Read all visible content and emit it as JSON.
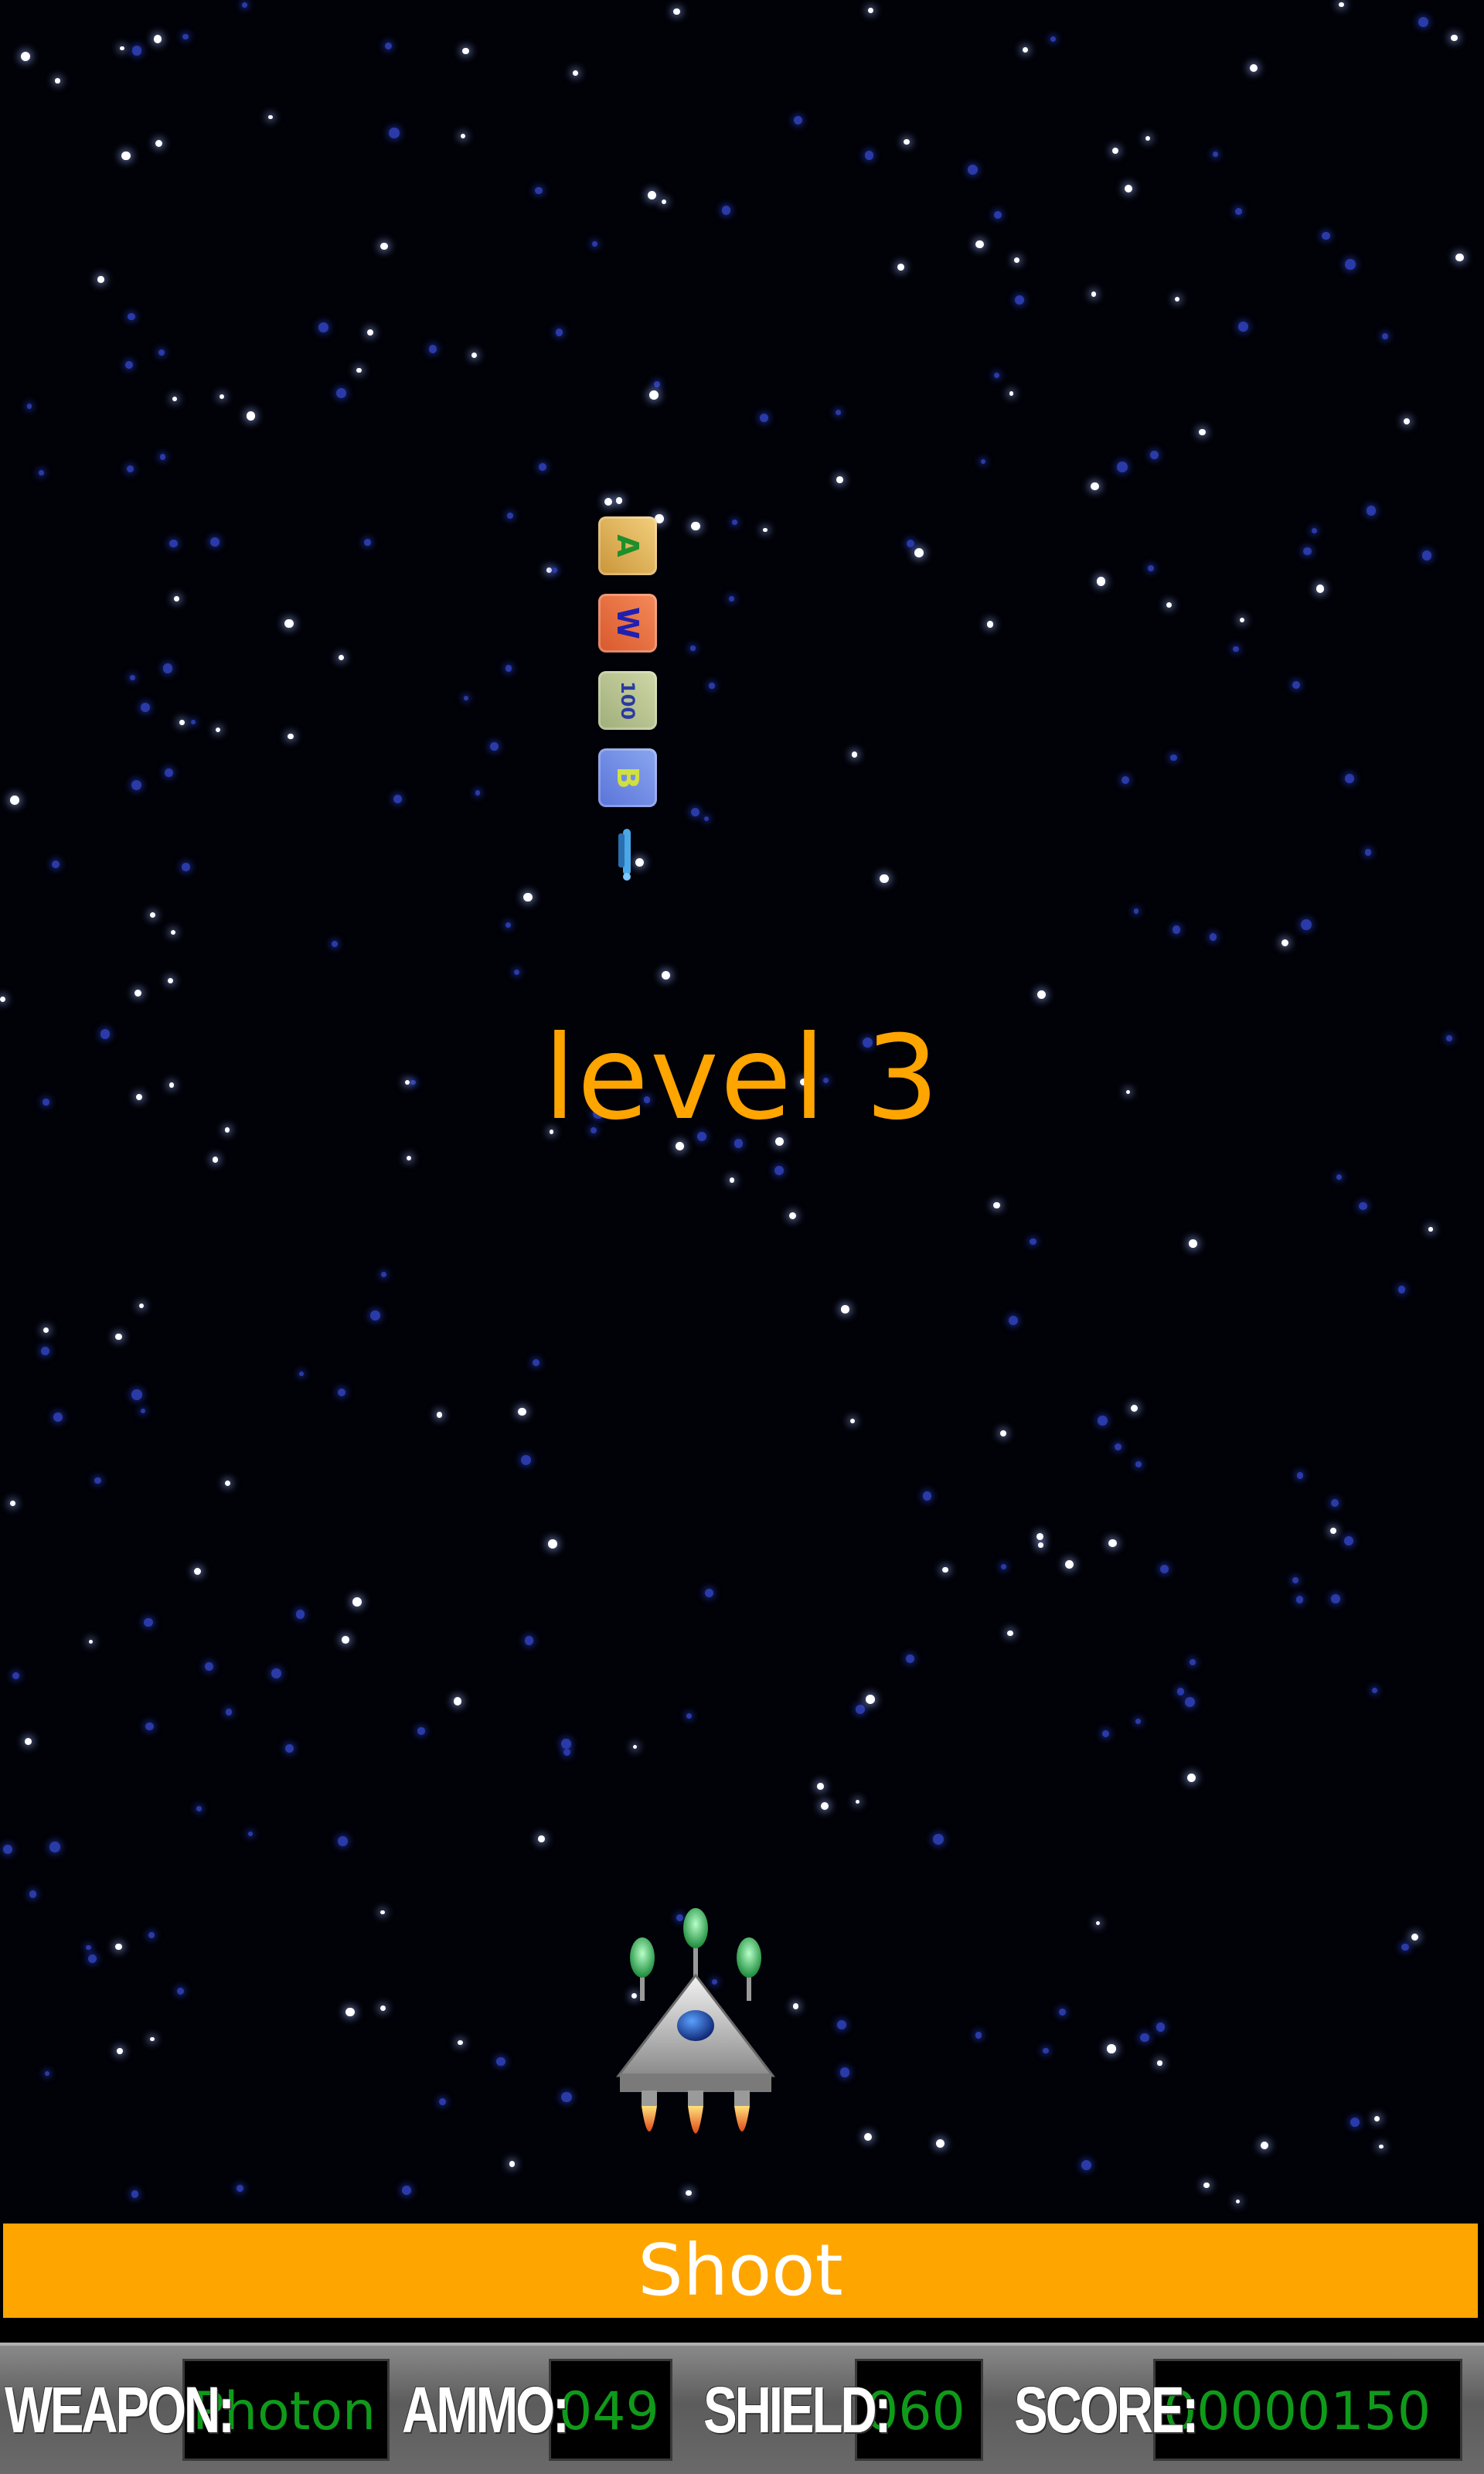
{
  "game": {
    "level_text": "level 3",
    "shoot_label": "Shoot",
    "pickups": [
      "A",
      "W",
      "100",
      "B"
    ]
  },
  "hud": {
    "weapon_label": "WEAPON:",
    "weapon_value": "Photon",
    "ammo_label": "AMMO:",
    "ammo_value": "049",
    "shield_label": "SHIELD:",
    "shield_value": "060",
    "score_label": "SCORE:",
    "score_value": "00000150"
  },
  "colors": {
    "accent": "#ffa500",
    "hud_value_text": "#0f9a1a",
    "background": "#010208"
  }
}
